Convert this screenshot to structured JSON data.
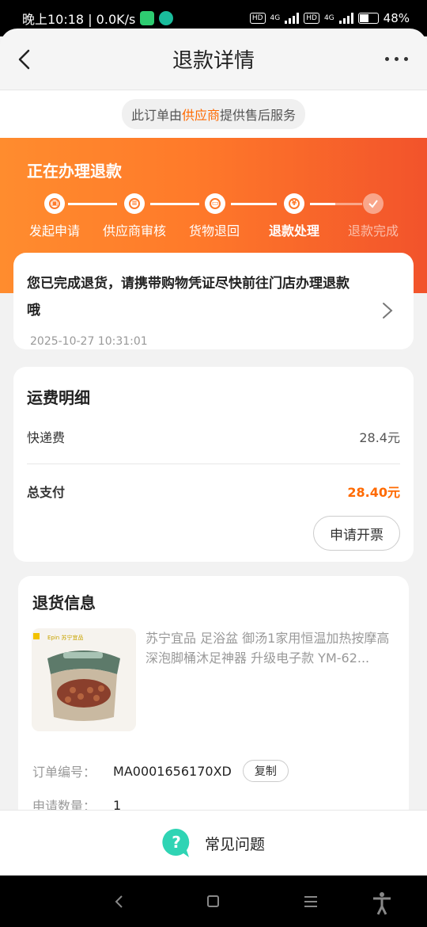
{
  "status_bar": {
    "time_speed": "晚上10:18 | 0.0K/s",
    "hd1": "HD",
    "hd2": "HD",
    "net1": "4G",
    "net2": "4G",
    "battery": "48%"
  },
  "header": {
    "title": "退款详情",
    "back_icon": "chevron-left-icon",
    "more_icon": "more-dots-icon"
  },
  "notice": {
    "prefix": "此订单由",
    "highlight": "供应商",
    "suffix": "提供售后服务",
    "highlight_color": "#ff6a00"
  },
  "progress": {
    "title": "正在办理退款",
    "steps": [
      {
        "label": "发起申请",
        "icon": "calendar-icon"
      },
      {
        "label": "供应商审核",
        "icon": "review-icon"
      },
      {
        "label": "货物退回",
        "icon": "box-icon"
      },
      {
        "label": "退款处理",
        "icon": "yen-icon"
      },
      {
        "label": "退款完成",
        "icon": "check-icon"
      }
    ],
    "current_step": 4
  },
  "refund_message": {
    "text": "您已完成退货，请携带购物凭证尽快前往门店办理退款哦",
    "time": "2025-10-27 10:31:01"
  },
  "shipping": {
    "title": "运费明细",
    "fee_label": "快递费",
    "fee_value": "28.4元",
    "total_label": "总支付",
    "total_value": "28.40元",
    "invoice_button": "申请开票"
  },
  "return_info": {
    "title": "退货信息",
    "product_name": "苏宁宜品 足浴盆 御汤1家用恒温加热按摩高深泡脚桶沐足神器 升级电子款 YM-62...",
    "thumb_brand": "苏宁宜品",
    "order_label": "订单编号：",
    "order_value": "MA0001656170XD",
    "copy_button": "复制",
    "qty_label": "申请数量：",
    "qty_value": "1"
  },
  "faq": {
    "label": "常见问题",
    "icon": "question-bubble-icon"
  },
  "colors": {
    "accent": "#ff6a00",
    "banner_start": "#ff8c2e",
    "banner_end": "#f2532b",
    "faq_icon": "#2fd4b4"
  }
}
